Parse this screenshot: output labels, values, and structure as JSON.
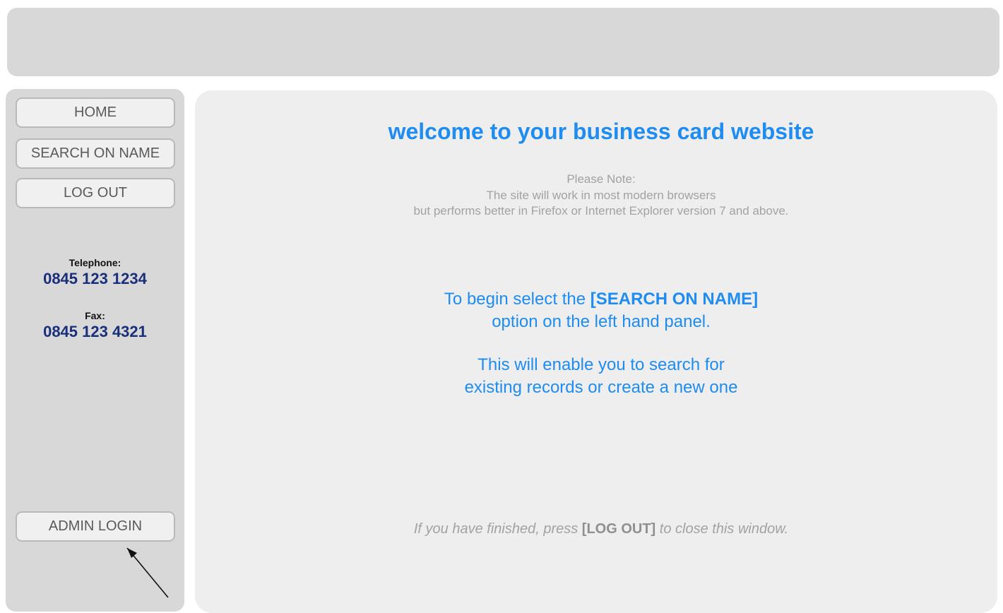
{
  "header": {},
  "sidebar": {
    "nav": {
      "home_label": "HOME",
      "search_label": "SEARCH ON NAME",
      "logout_label": "LOG OUT"
    },
    "contact": {
      "telephone_label": "Telephone:",
      "telephone_number": "0845 123 1234",
      "fax_label": "Fax:",
      "fax_number": "0845 123 4321"
    },
    "admin_login_label": "ADMIN LOGIN",
    "arrow_icon": "arrow-up-left-icon"
  },
  "main": {
    "title": "welcome to your business card website",
    "note": {
      "line1": "Please Note:",
      "line2": "The site will work in most modern browsers",
      "line3": "but performs better in Firefox or Internet Explorer version 7 and above."
    },
    "instructions": {
      "line1_prefix": "To begin select the ",
      "line1_emphasis": "[SEARCH ON NAME]",
      "line2": "option on the left hand panel.",
      "line3": "This will enable you to search for",
      "line4": "existing records or create a new one"
    },
    "finish_note": {
      "prefix": "If you have finished, press ",
      "emphasis": "[LOG OUT]",
      "suffix": " to close this window."
    }
  },
  "colors": {
    "accent_blue": "#1e8cf0",
    "contact_navy": "#1a2f7a",
    "panel_gray": "#d8d8d8",
    "main_gray": "#eeeeee",
    "muted_text": "#a2a2a2"
  }
}
